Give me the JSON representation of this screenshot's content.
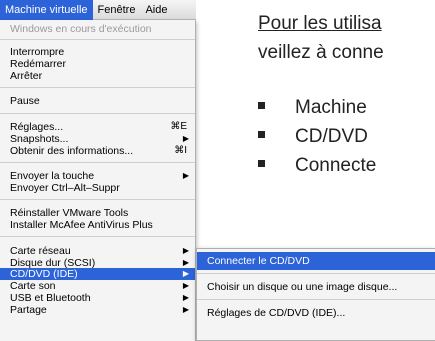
{
  "slide": {
    "line1": "Pour les utilisa",
    "line2": "veillez à conne",
    "bullets": [
      "Machine",
      "CD/DVD",
      "Connecte"
    ]
  },
  "menubar": {
    "items": [
      "Machine virtuelle",
      "Fenêtre",
      "Aide"
    ],
    "active_index": 0
  },
  "menu": {
    "running": "Windows en cours d'exécution",
    "interrupt": "Interrompre",
    "restart": "Redémarrer",
    "stop": "Arrêter",
    "pause": "Pause",
    "settings": "Réglages...",
    "settings_shortcut": "⌘E",
    "snapshots": "Snapshots...",
    "info": "Obtenir des informations...",
    "info_shortcut": "⌘I",
    "send_key": "Envoyer la touche",
    "send_ctrl_alt_del": "Envoyer Ctrl–Alt–Suppr",
    "reinstall_tools": "Réinstaller VMware Tools",
    "install_mcafee": "Installer McAfee AntiVirus Plus",
    "network": "Carte réseau",
    "hard_disk": "Disque dur (SCSI)",
    "cd_dvd": "CD/DVD (IDE)",
    "sound": "Carte son",
    "usb": "USB et Bluetooth",
    "share": "Partage",
    "arrow": "▶"
  },
  "submenu": {
    "connect": "Connecter le CD/DVD",
    "choose": "Choisir un disque ou une image disque...",
    "settings": "Réglages de CD/DVD (IDE)..."
  },
  "colors": {
    "highlight": "#2d63d8",
    "menu_bg": "#f4f4f4"
  }
}
